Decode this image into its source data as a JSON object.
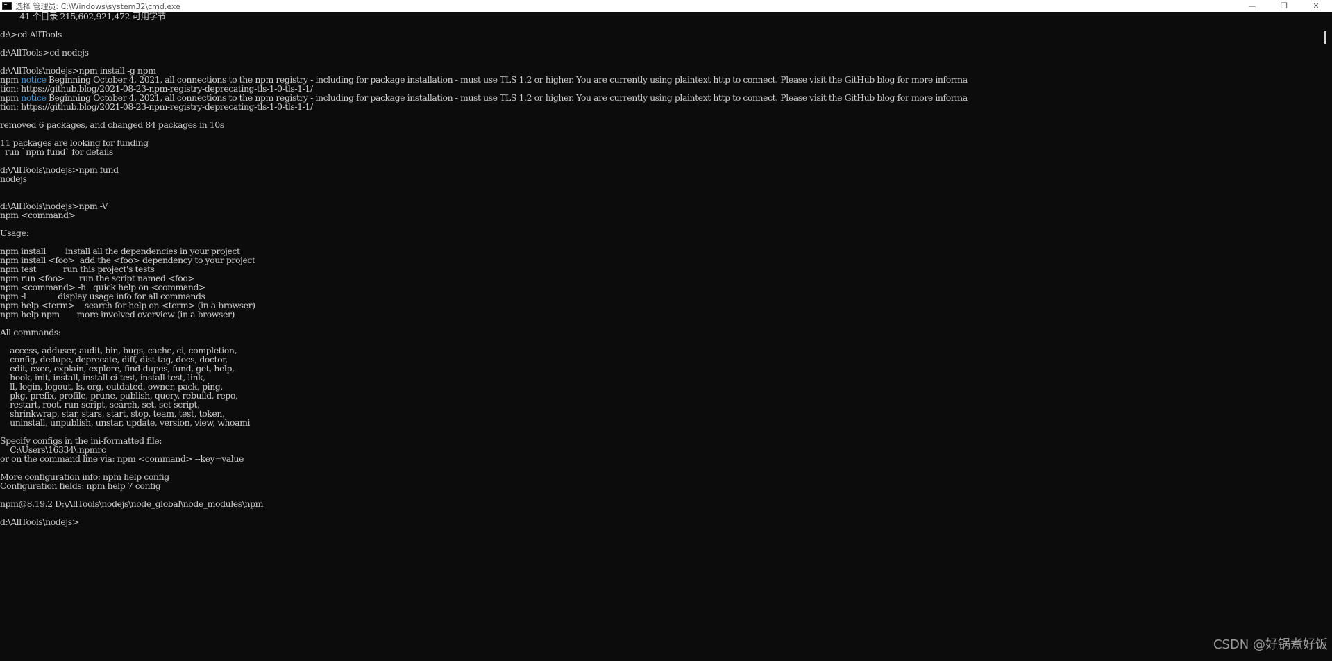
{
  "window": {
    "title": "选择 管理员: C:\\Windows\\system32\\cmd.exe",
    "controls": {
      "minimize": "—",
      "maximize": "❐",
      "close": "✕"
    }
  },
  "console": {
    "lines": [
      "        41 个目录 215,602,921,472 可用字节",
      "",
      "d:\\>cd AllTools",
      "",
      "d:\\AllTools>cd nodejs",
      "",
      "d:\\AllTools\\nodejs>npm install -g npm",
      "npm notice Beginning October 4, 2021, all connections to the npm registry - including for package installation - must use TLS 1.2 or higher. You are currently using plaintext http to connect. Please visit the GitHub blog for more informa",
      "tion: https://github.blog/2021-08-23-npm-registry-deprecating-tls-1-0-tls-1-1/",
      "npm notice Beginning October 4, 2021, all connections to the npm registry - including for package installation - must use TLS 1.2 or higher. You are currently using plaintext http to connect. Please visit the GitHub blog for more informa",
      "tion: https://github.blog/2021-08-23-npm-registry-deprecating-tls-1-0-tls-1-1/",
      "",
      "removed 6 packages, and changed 84 packages in 10s",
      "",
      "11 packages are looking for funding",
      "  run `npm fund` for details",
      "",
      "d:\\AllTools\\nodejs>npm fund",
      "nodejs",
      "",
      "",
      "d:\\AllTools\\nodejs>npm -V",
      "npm <command>",
      "",
      "Usage:",
      "",
      "npm install        install all the dependencies in your project",
      "npm install <foo>  add the <foo> dependency to your project",
      "npm test           run this project's tests",
      "npm run <foo>      run the script named <foo>",
      "npm <command> -h   quick help on <command>",
      "npm -l             display usage info for all commands",
      "npm help <term>    search for help on <term> (in a browser)",
      "npm help npm       more involved overview (in a browser)",
      "",
      "All commands:",
      "",
      "    access, adduser, audit, bin, bugs, cache, ci, completion,",
      "    config, dedupe, deprecate, diff, dist-tag, docs, doctor,",
      "    edit, exec, explain, explore, find-dupes, fund, get, help,",
      "    hook, init, install, install-ci-test, install-test, link,",
      "    ll, login, logout, ls, org, outdated, owner, pack, ping,",
      "    pkg, prefix, profile, prune, publish, query, rebuild, repo,",
      "    restart, root, run-script, search, set, set-script,",
      "    shrinkwrap, star, stars, start, stop, team, test, token,",
      "    uninstall, unpublish, unstar, update, version, view, whoami",
      "",
      "Specify configs in the ini-formatted file:",
      "    C:\\Users\\16334\\.npmrc",
      "or on the command line via: npm <command> --key=value",
      "",
      "More configuration info: npm help config",
      "Configuration fields: npm help 7 config",
      "",
      "npm@8.19.2 D:\\AllTools\\nodejs\\node_global\\node_modules\\npm",
      "",
      "d:\\AllTools\\nodejs>"
    ]
  },
  "colors": {
    "background": "#0c0c0c",
    "text": "#cccccc",
    "notice": "#3a96dd"
  },
  "watermark": "CSDN @好锅煮好饭"
}
